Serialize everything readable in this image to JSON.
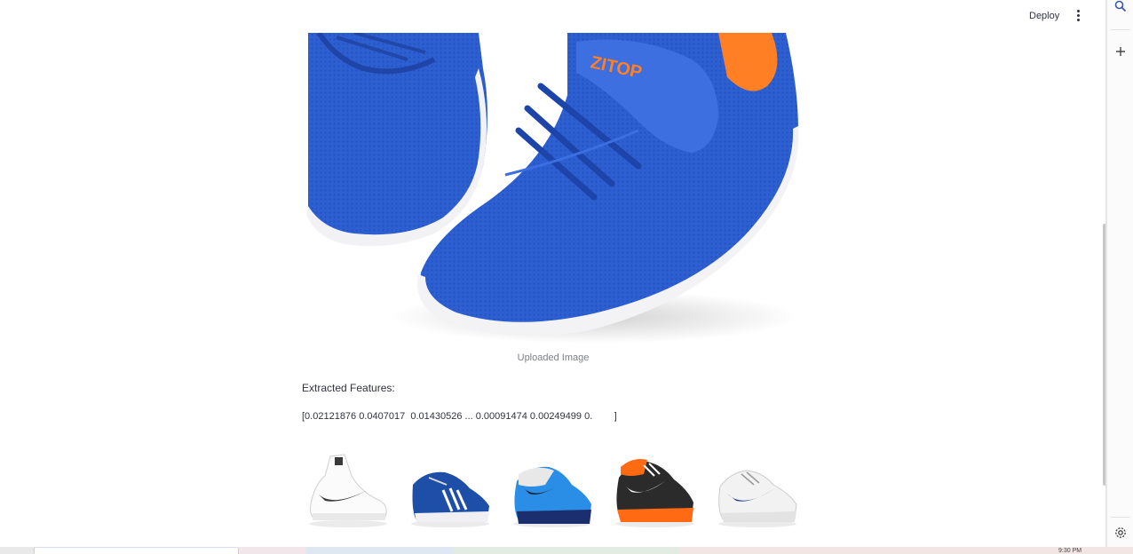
{
  "topbar": {
    "deploy_label": "Deploy",
    "menu_icon": "kebab-menu-icon"
  },
  "hero": {
    "caption": "Uploaded Image",
    "colors": {
      "mesh": "#2d5fd1",
      "sole": "#f4f4f6",
      "accent": "#ff7f24",
      "brand_text": "ZITOP"
    }
  },
  "features": {
    "label": "Extracted Features:",
    "vector": "[0.02121876 0.0407017  0.01430526 ... 0.00091474 0.00249499 0.        ]"
  },
  "recommendations": [
    {
      "name": "white-high-top-sneaker",
      "color": "#ffffff",
      "accent": "#3a3a3a"
    },
    {
      "name": "blue-running-shoe",
      "color": "#1d4fa8",
      "accent": "#ffffff"
    },
    {
      "name": "blue-tennis-shoe",
      "color": "#2a8de6",
      "accent": "#e8e8e8"
    },
    {
      "name": "black-orange-runner",
      "color": "#2b2b2b",
      "accent": "#ff6a13"
    },
    {
      "name": "white-navy-sneaker",
      "color": "#f2f2f2",
      "accent": "#1e3c88"
    }
  ],
  "right_rail": {
    "icons": [
      "search-icon",
      "plus-icon",
      "settings-icon"
    ]
  },
  "taskbar": {
    "clock": "9:30 PM"
  }
}
